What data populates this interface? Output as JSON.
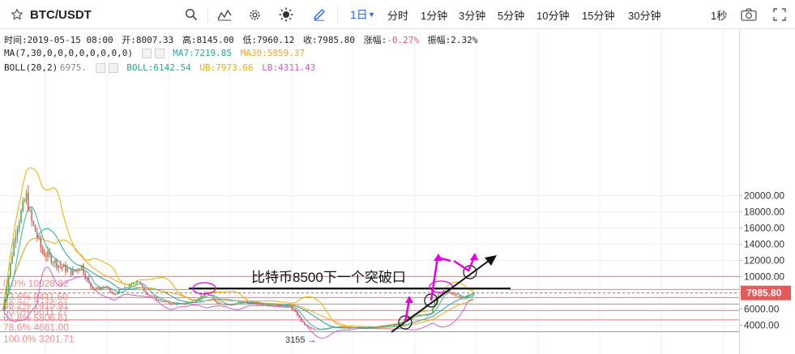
{
  "toolbar": {
    "symbol": "BTC/USDT",
    "active_interval": "1日",
    "intervals": [
      "分时",
      "1分钟",
      "3分钟",
      "5分钟",
      "10分钟",
      "15分钟",
      "30分钟"
    ],
    "right_interval": "1秒"
  },
  "info": {
    "time_label": "时间:2019-05-15 08:00",
    "open_label": "开:8007.33",
    "high_label": "高:8145.00",
    "low_label": "低:7960.12",
    "close_label": "收:7985.80",
    "change_label": "涨幅:",
    "change_value": "-0.27%",
    "amp_label": "振幅:2.32%",
    "ma_label": "MA(7,30,0,0,0,0,0,0,0,0)",
    "ma7_label": "MA7:7219.85",
    "ma30_label": "MA30:5859.37",
    "boll_label": "BOLL(20,2)",
    "boll_hidden": "6975.",
    "boll_value": "BOLL:6142.54",
    "ub_value": "UB:7973.66",
    "lb_value": "LB:4311.43"
  },
  "colors": {
    "up": "#5aa35a",
    "down": "#e45b5b",
    "ma7": "#26a69a",
    "ma30": "#f5a623",
    "boll": "#26a69a",
    "ub": "#e8b000",
    "lb": "#d05ed0",
    "fib": "#e77b7b",
    "arrow": "#e600e6",
    "price_tag": "#e45b5b"
  },
  "chart_data": {
    "type": "candlestick",
    "y_axis_ticks": [
      4000,
      6000,
      8000,
      10000,
      12000,
      14000,
      16000,
      18000,
      20000
    ],
    "y_tick_labels": [
      "4000.00",
      "6000.00",
      "8000.00",
      "10000.00",
      "12000.00",
      "14000.00",
      "16000.00",
      "18000.00",
      "20000.00"
    ],
    "current_price": "7985.80",
    "fib_levels": [
      {
        "label": "0.0% 10028.82",
        "value": 10028.82
      },
      {
        "label": "23.6% 8411.50",
        "value": 8411.5
      },
      {
        "label": "38.2% 7415.91",
        "value": 7415.91
      },
      {
        "label": "50.0% 6611.27",
        "value": 6611.27
      },
      {
        "label": "61.8% 5806.61",
        "value": 5806.61
      },
      {
        "label": "78.6% 4661.00",
        "value": 4661.0
      },
      {
        "label": "100.0% 3201.71",
        "value": 3201.71
      }
    ],
    "low_marker": "3155",
    "annotation": "比特币8500下一个突破口"
  }
}
